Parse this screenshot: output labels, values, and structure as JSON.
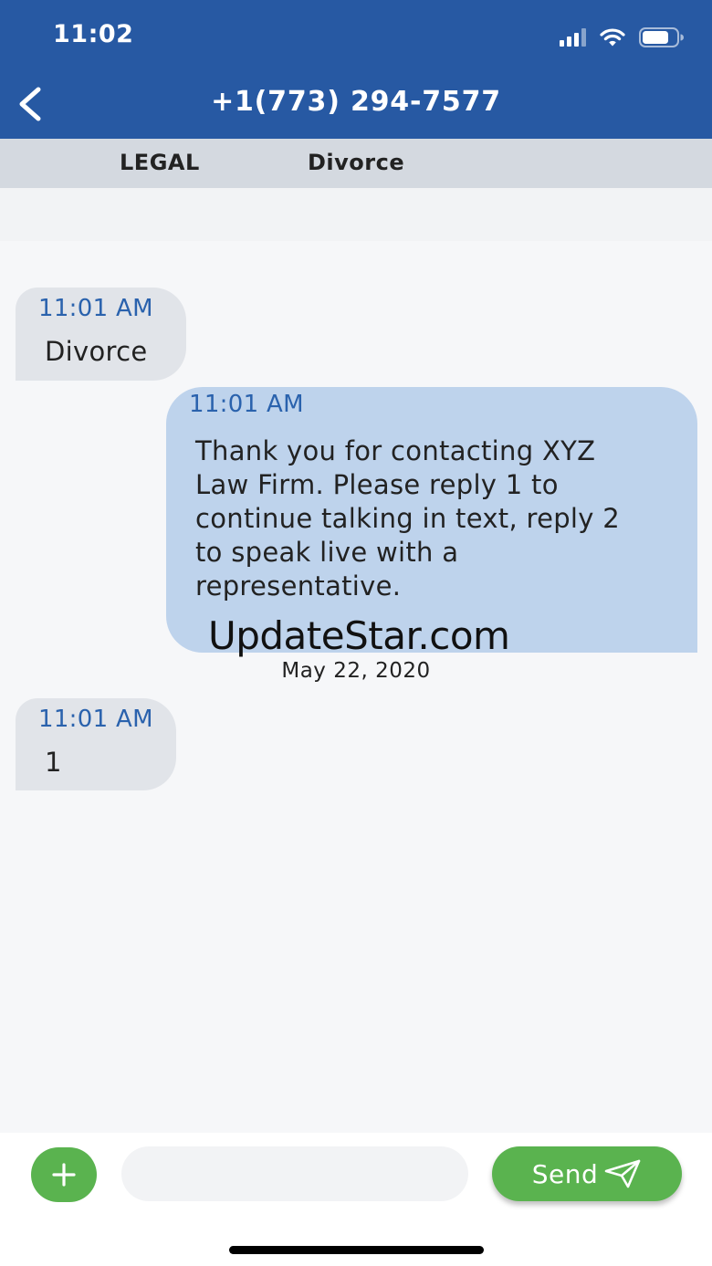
{
  "status_bar": {
    "time": "11:02",
    "icons": [
      "cellular-signal-icon",
      "wifi-icon",
      "battery-icon"
    ]
  },
  "header": {
    "title": "+1(773) 294-7577",
    "back_icon": "chevron-left-icon"
  },
  "tags": {
    "category": "LEGAL",
    "topic": "Divorce"
  },
  "messages": [
    {
      "direction": "incoming",
      "time": "11:01 AM",
      "text": "Divorce"
    },
    {
      "direction": "outgoing",
      "time": "11:01 AM",
      "lines": [
        "Thank you for contacting XYZ",
        "Law Firm. Please reply 1 to",
        "continue talking in text, reply 2",
        "to speak live with a",
        "representative."
      ]
    },
    {
      "direction": "incoming",
      "time": "11:01 AM",
      "text": "1"
    }
  ],
  "watermark": "UpdateStar.com",
  "date_separator": "May 22, 2020",
  "composer": {
    "input_value": "",
    "input_placeholder": "",
    "send_label": "Send",
    "add_icon": "plus-icon",
    "send_icon": "paper-plane-icon"
  },
  "colors": {
    "header_bg": "#2759a3",
    "accent_green": "#5ab34f",
    "outgoing_bubble": "#bed3ec",
    "incoming_bubble": "#e1e4e9",
    "timestamp_blue": "#2a62ad"
  }
}
